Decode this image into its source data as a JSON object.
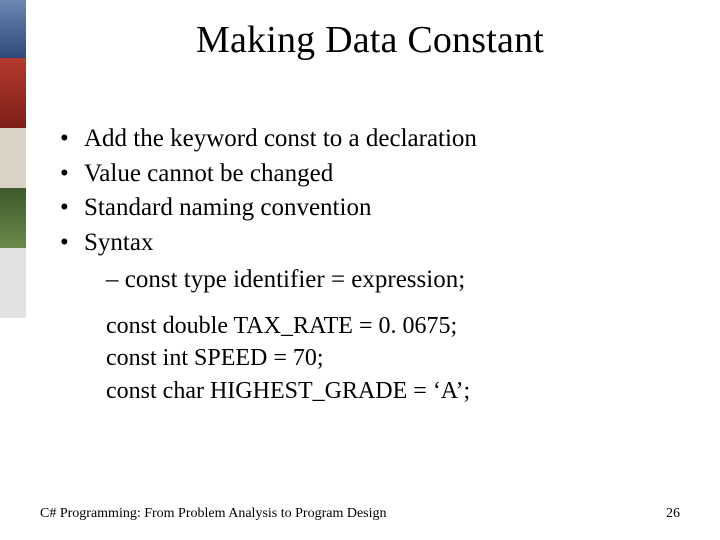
{
  "title": "Making Data Constant",
  "bullets": [
    "Add the keyword const to a declaration",
    "Value cannot be changed",
    "Standard naming convention",
    "Syntax"
  ],
  "sub_bullet": "–  const type identifier = expression;",
  "code_lines": [
    "const double TAX_RATE = 0. 0675;",
    "const int SPEED = 70;",
    "const char HIGHEST_GRADE = ‘A’;"
  ],
  "footer_text": "C# Programming: From Problem Analysis to Program Design",
  "page_number": "26"
}
